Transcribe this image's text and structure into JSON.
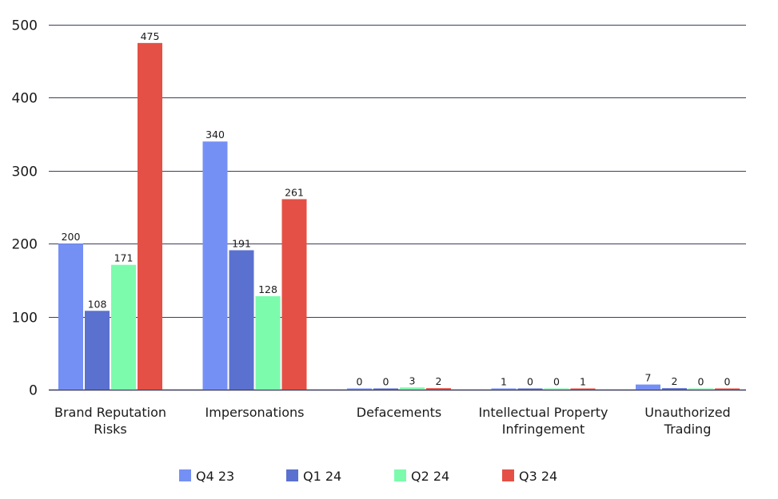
{
  "chart_data": {
    "type": "bar",
    "title": "",
    "xlabel": "",
    "ylabel": "",
    "ylim": [
      0,
      500
    ],
    "yticks": [
      0,
      100,
      200,
      300,
      400,
      500
    ],
    "grid": true,
    "legend_position": "bottom",
    "categories": [
      [
        "Brand Reputation",
        "Risks"
      ],
      [
        "Impersonations"
      ],
      [
        "Defacements"
      ],
      [
        "Intellectual Property",
        "Infringement"
      ],
      [
        "Unauthorized",
        "Trading"
      ]
    ],
    "series": [
      {
        "name": "Q4 23",
        "color": "#7590F5",
        "values": [
          200,
          340,
          0,
          1,
          7
        ]
      },
      {
        "name": "Q1 24",
        "color": "#5B71CF",
        "values": [
          108,
          191,
          0,
          0,
          2
        ]
      },
      {
        "name": "Q2 24",
        "color": "#7CFBAD",
        "values": [
          171,
          128,
          3,
          0,
          0
        ]
      },
      {
        "name": "Q3 24",
        "color": "#E45045",
        "values": [
          475,
          261,
          2,
          1,
          0
        ]
      }
    ]
  }
}
